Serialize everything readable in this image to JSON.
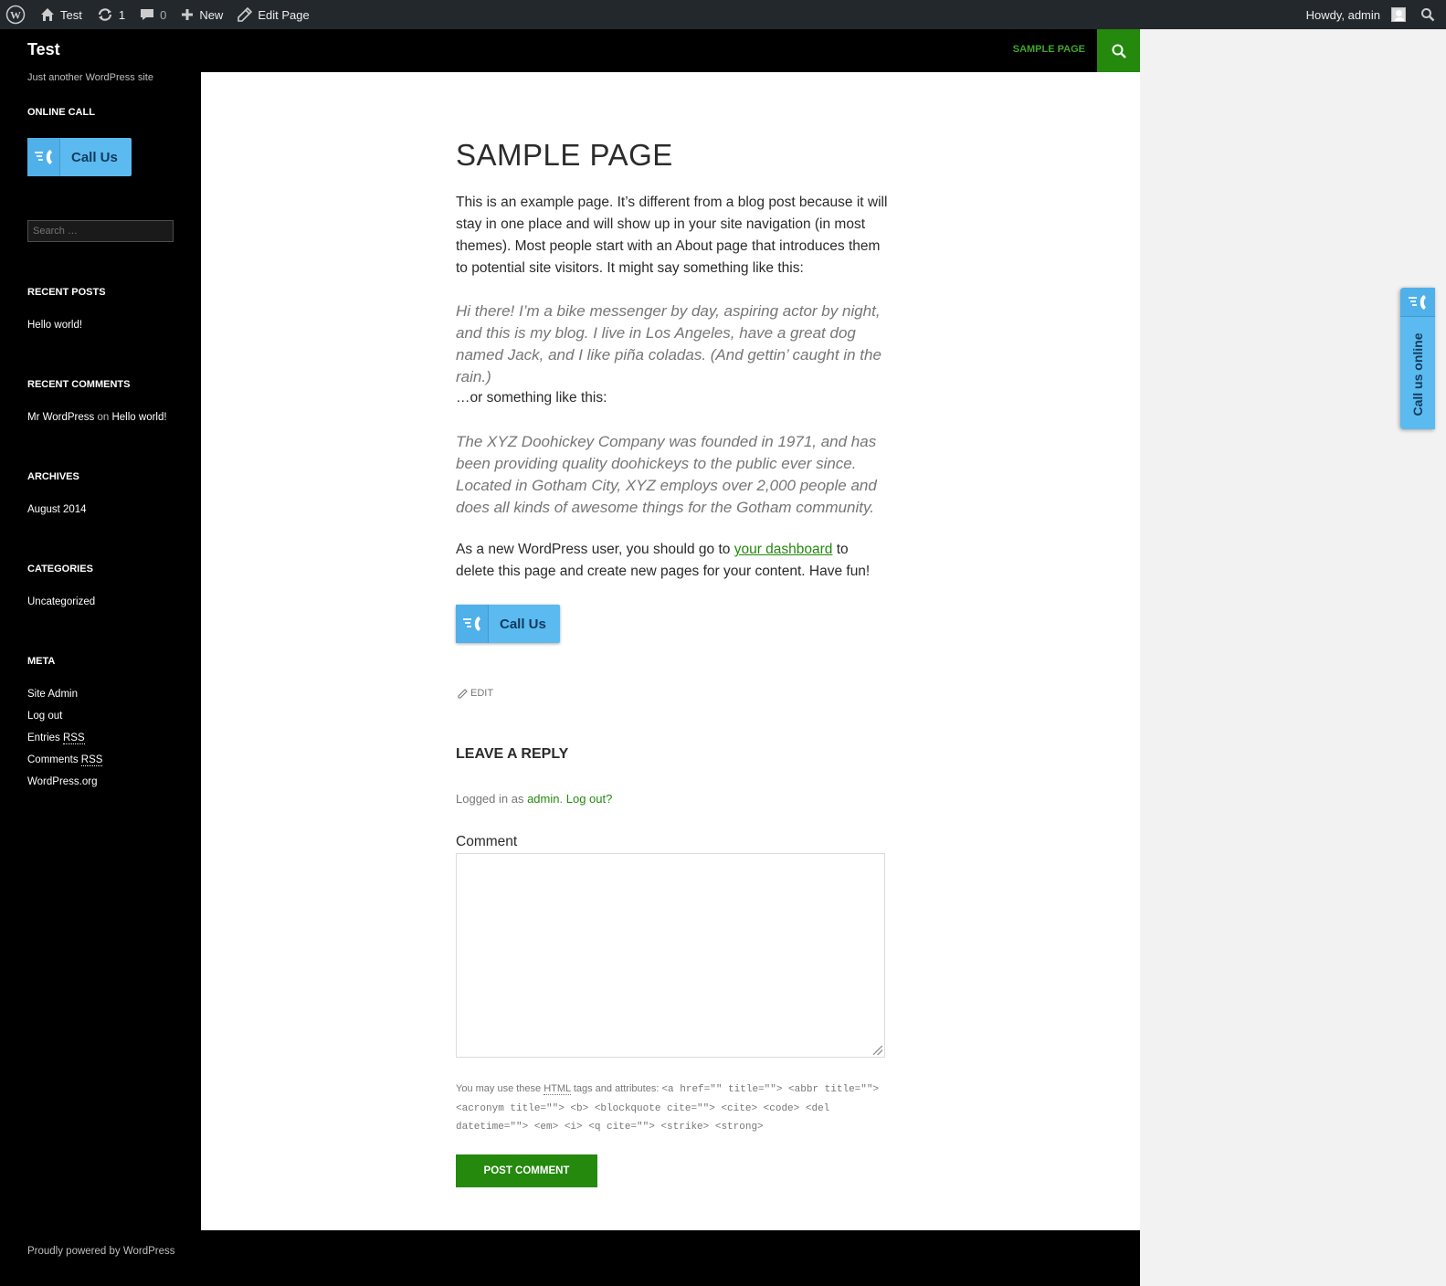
{
  "admin_bar": {
    "site_name": "Test",
    "updates_count": "1",
    "comments_count": "0",
    "new_label": "New",
    "edit_label": "Edit Page",
    "greeting": "Howdy, admin"
  },
  "site": {
    "title": "Test",
    "description": "Just another WordPress site"
  },
  "sidebar": {
    "online_call_title": "ONLINE CALL",
    "call_button_label": "Call Us",
    "search_placeholder": "Search …",
    "recent_posts_title": "RECENT POSTS",
    "recent_posts": [
      "Hello world!"
    ],
    "recent_comments_title": "RECENT COMMENTS",
    "recent_comment": {
      "author": "Mr WordPress",
      "on": "on",
      "post": "Hello world!"
    },
    "archives_title": "ARCHIVES",
    "archives": [
      "August 2014"
    ],
    "categories_title": "CATEGORIES",
    "categories": [
      "Uncategorized"
    ],
    "meta_title": "META",
    "meta": {
      "site_admin": "Site Admin",
      "log_out": "Log out",
      "entries_prefix": "Entries ",
      "comments_prefix": "Comments ",
      "rss": "RSS",
      "wordpress_org": "WordPress.org"
    }
  },
  "header": {
    "nav_item": "SAMPLE PAGE"
  },
  "content": {
    "title": "SAMPLE PAGE",
    "paragraph1": "This is an example page. It’s different from a blog post because it will stay in one place and will show up in your site navigation (in most themes). Most people start with an About page that introduces them to potential site visitors. It might say something like this:",
    "quote1": "Hi there! I’m a bike messenger by day, aspiring actor by night, and this is my blog. I live in Los Angeles, have a great dog named Jack, and I like piña coladas. (And gettin’ caught in the rain.)",
    "paragraph2": "…or something like this:",
    "quote2": "The XYZ Doohickey Company was founded in 1971, and has been providing quality doohickeys to the public ever since. Located in Gotham City, XYZ employs over 2,000 people and does all kinds of awesome things for the Gotham community.",
    "paragraph3_before": "As a new WordPress user, you should go to ",
    "paragraph3_link": "your dashboard",
    "paragraph3_after": " to delete this page and create new pages for your content. Have fun!",
    "call_button_label": "Call Us",
    "edit_label": "EDIT"
  },
  "reply": {
    "title": "LEAVE A REPLY",
    "logged_in_prefix": "Logged in as ",
    "user": "admin",
    "logout": "Log out?",
    "comment_label": "Comment",
    "allowed_prefix": "You may use these ",
    "html_abbr": "HTML",
    "allowed_mid": " tags and attributes: ",
    "allowed_code": "<a href=\"\" title=\"\"> <abbr title=\"\"> <acronym title=\"\"> <b> <blockquote cite=\"\"> <cite> <code> <del datetime=\"\"> <em> <i> <q cite=\"\"> <strike> <strong>",
    "submit_label": "POST COMMENT"
  },
  "footer": {
    "text": "Proudly powered by WordPress"
  },
  "side_tab": {
    "label": "Call us online"
  },
  "colors": {
    "accent_green": "#24890d",
    "link_green": "#41a62a",
    "call_blue": "#5bbaf0"
  }
}
